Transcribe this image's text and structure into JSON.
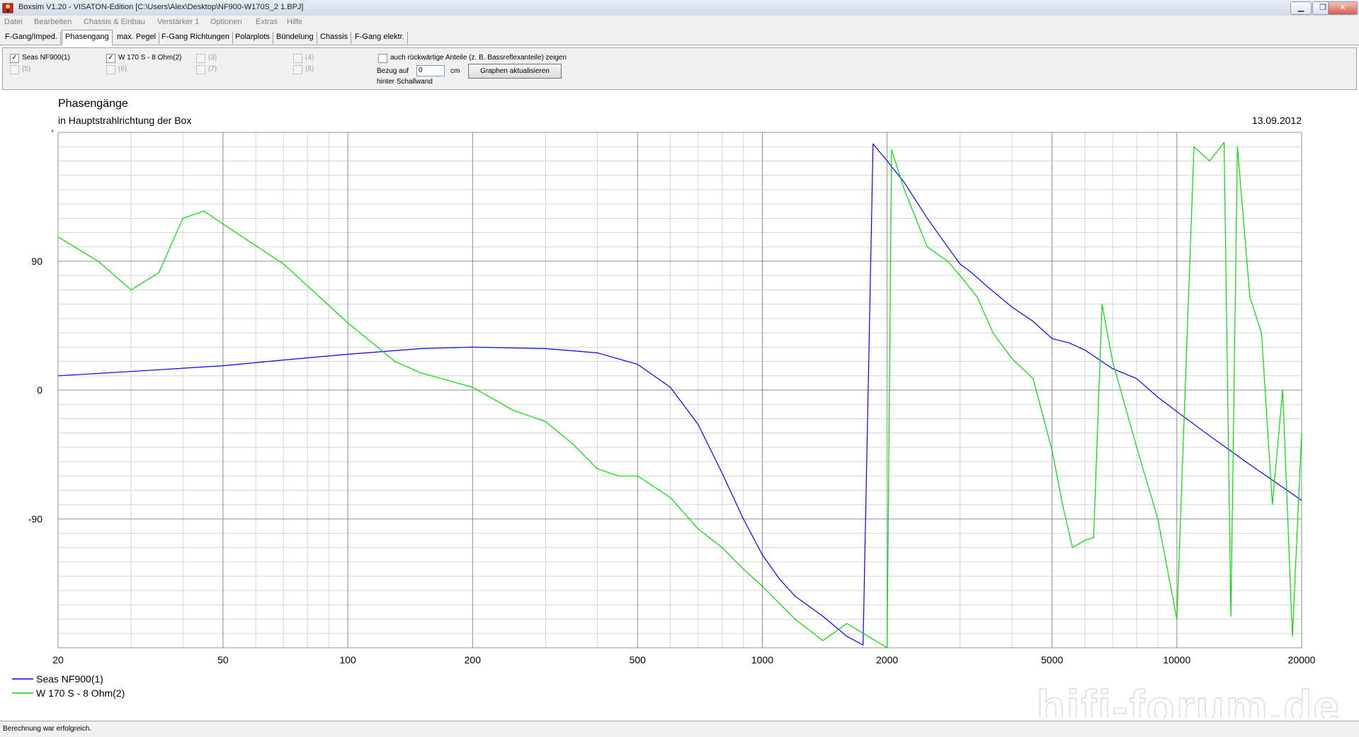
{
  "window": {
    "title": "Boxsim V1.20 - VISATON-Edition [C:\\Users\\Alex\\Desktop\\NF900-W170S_2 1.BPJ]",
    "minimize_label": "▁",
    "maximize_label": "❐",
    "close_label": "✕"
  },
  "menu": [
    "Datei",
    "Bearbeiten",
    "Chassis & Einbau",
    "Verstärker 1",
    "Optionen",
    "Extras",
    "Hilfe"
  ],
  "tabs": [
    "F-Gang/Imped.",
    "Phasengang",
    "max. Pegel",
    "F-Gang Richtungen",
    "Polarplots",
    "Bündelung",
    "Chassis",
    "F-Gang elektr."
  ],
  "active_tab": "Phasengang",
  "chassis": [
    {
      "label": "Seas NF900(1)",
      "checked": true,
      "enabled": true
    },
    {
      "label": "(5)",
      "checked": false,
      "enabled": false
    },
    {
      "label": "W 170 S - 8 Ohm(2)",
      "checked": true,
      "enabled": true
    },
    {
      "label": "(6)",
      "checked": false,
      "enabled": false
    },
    {
      "label": "(3)",
      "checked": false,
      "enabled": false
    },
    {
      "label": "(7)",
      "checked": false,
      "enabled": false
    },
    {
      "label": "(4)",
      "checked": false,
      "enabled": false
    },
    {
      "label": "(8)",
      "checked": false,
      "enabled": false
    }
  ],
  "options": {
    "rear_label": "auch rückwärtige Anteile (z. B. Bassreflexanteile) zeigen",
    "bezug_label": "Bezug auf",
    "bezug_value": "0",
    "unit_label": "cm",
    "wall_label": "hinter Schallwand",
    "update_button": "Graphen aktualisieren"
  },
  "chart_data": {
    "type": "line",
    "title": "Phasengänge",
    "subtitle": "in Hauptstrahlrichtung der Box",
    "date": "13.09.2012",
    "y_unit": "°",
    "xscale": "log",
    "xlim": [
      20,
      20000
    ],
    "ylim": [
      -180,
      180
    ],
    "x_ticks": [
      20,
      50,
      100,
      200,
      500,
      1000,
      2000,
      5000,
      10000,
      20000
    ],
    "x_tick_labels": [
      "20",
      "50",
      "100",
      "200",
      "500",
      "1000",
      "2000",
      "5000",
      "10000",
      "20000"
    ],
    "y_ticks": [
      90,
      0,
      -90
    ],
    "y_tick_labels": [
      "90",
      "0",
      "-90"
    ],
    "grid": true,
    "legend_position": "bottom-left",
    "series": [
      {
        "name": "Seas NF900(1)",
        "color": "#0000ff",
        "x": [
          20,
          30,
          50,
          70,
          100,
          150,
          200,
          300,
          400,
          500,
          600,
          700,
          800,
          900,
          1000,
          1100,
          1200,
          1400,
          1600,
          1750,
          1800,
          1850,
          2000,
          2200,
          2500,
          2800,
          3000,
          3200,
          3500,
          4000,
          4500,
          5000,
          5500,
          6000,
          7000,
          8000,
          9000,
          10000,
          12000,
          15000,
          20000
        ],
        "y": [
          10,
          13,
          17,
          21,
          25,
          29,
          30,
          29,
          26,
          18,
          2,
          -24,
          -58,
          -90,
          -115,
          -132,
          -144,
          -158,
          -172,
          -178,
          0,
          172,
          160,
          145,
          120,
          100,
          88,
          82,
          72,
          58,
          48,
          36,
          33,
          28,
          15,
          8,
          -5,
          -15,
          -32,
          -52,
          -77
        ]
      },
      {
        "name": "W 170 S - 8 Ohm(2)",
        "color": "#00dd00",
        "x": [
          20,
          25,
          30,
          35,
          40,
          45,
          50,
          70,
          100,
          130,
          150,
          200,
          250,
          300,
          350,
          400,
          450,
          500,
          600,
          700,
          800,
          900,
          1000,
          1200,
          1400,
          1600,
          1800,
          2000,
          2050,
          2200,
          2500,
          2800,
          3000,
          3300,
          3600,
          4000,
          4500,
          5000,
          5300,
          5600,
          6000,
          6300,
          6600,
          7000,
          8000,
          9000,
          10000,
          11000,
          12000,
          13000,
          13500,
          14000,
          15000,
          16000,
          17000,
          18000,
          19000,
          20000
        ],
        "y": [
          107,
          90,
          70,
          82,
          120,
          125,
          116,
          88,
          47,
          20,
          12,
          2,
          -14,
          -22,
          -38,
          -55,
          -60,
          -60,
          -75,
          -97,
          -110,
          -125,
          -137,
          -160,
          -175,
          -163,
          -172,
          -180,
          168,
          140,
          100,
          90,
          80,
          65,
          40,
          22,
          8,
          -42,
          -80,
          -110,
          -105,
          -103,
          60,
          20,
          -40,
          -90,
          -160,
          170,
          160,
          173,
          -158,
          170,
          65,
          40,
          -80,
          0,
          -172,
          -30
        ]
      }
    ]
  },
  "status": "Berechnung war erfolgreich.",
  "watermark": "hifi-forum.de"
}
